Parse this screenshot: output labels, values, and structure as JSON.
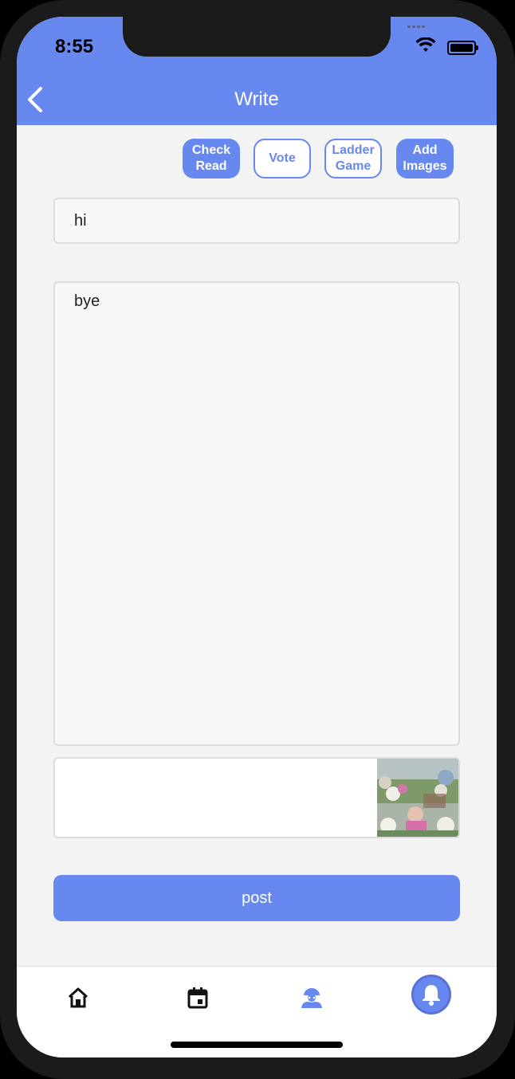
{
  "status_bar": {
    "time": "8:55"
  },
  "header": {
    "title": "Write"
  },
  "actions": [
    {
      "label_line1": "Check",
      "label_line2": "Read",
      "style": "filled"
    },
    {
      "label_line1": "Vote",
      "label_line2": "",
      "style": "outline"
    },
    {
      "label_line1": "Ladder",
      "label_line2": "Game",
      "style": "outline"
    },
    {
      "label_line1": "Add",
      "label_line2": "Images",
      "style": "filled"
    }
  ],
  "form": {
    "title_value": "hi",
    "body_value": "bye",
    "post_label": "post"
  },
  "tabbar": {
    "items": [
      {
        "icon": "home-icon"
      },
      {
        "icon": "calendar-icon"
      },
      {
        "icon": "profile-icon"
      },
      {
        "icon": "bell-icon",
        "active": true
      }
    ]
  },
  "colors": {
    "accent": "#6789ef",
    "background": "#f3f3f3"
  }
}
